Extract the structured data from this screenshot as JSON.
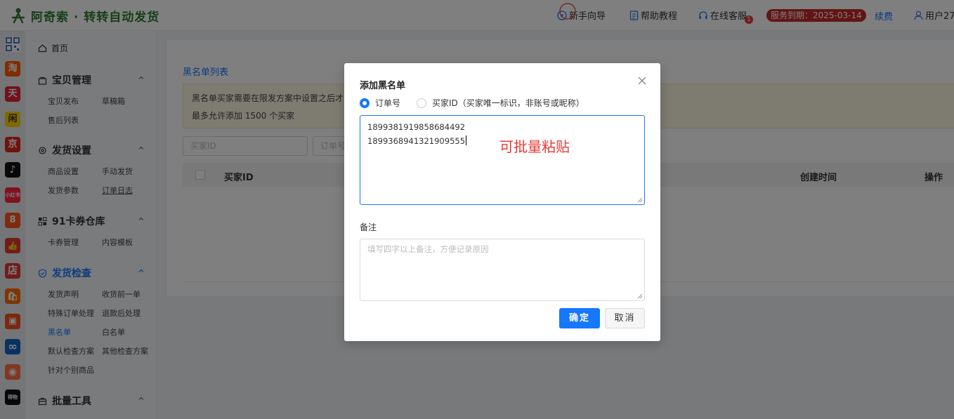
{
  "header": {
    "app_name": "阿奇索 · 转转自动发货",
    "nav": {
      "guide": "新手向导",
      "help": "帮助教程",
      "support": "在线客服",
      "support_badge": "1",
      "service_expiry": "服务到期：2025-03-14",
      "renew": "续费",
      "user": "用户27"
    }
  },
  "rail": {
    "icons": [
      {
        "name": "qr-grid-icon",
        "label": "",
        "color": "#3f6fb5"
      },
      {
        "name": "taobao-icon",
        "label": "淘",
        "color": "#ff5a00"
      },
      {
        "name": "tmall-icon",
        "label": "天",
        "color": "#e0253a"
      },
      {
        "name": "xianyu-icon",
        "label": "闲",
        "color": "#ffd500"
      },
      {
        "name": "jd-icon",
        "label": "京",
        "color": "#e1251b"
      },
      {
        "name": "douyin-icon",
        "label": "♪",
        "color": "#111111"
      },
      {
        "name": "xiaohongshu-icon",
        "label": "小红书",
        "color": "#ff2442"
      },
      {
        "name": "circle-app-icon",
        "label": "8",
        "color": "#ff5722"
      },
      {
        "name": "thumb-icon",
        "label": "👍",
        "color": "#e53935"
      },
      {
        "name": "shop-icon",
        "label": "店",
        "color": "#e53935"
      },
      {
        "name": "bag-icon",
        "label": "🛍",
        "color": "#ff6d00"
      },
      {
        "name": "store-icon",
        "label": "▣",
        "color": "#f4511e"
      },
      {
        "name": "link-icon",
        "label": "∞",
        "color": "#1565c0"
      },
      {
        "name": "face-icon",
        "label": "◉",
        "color": "#ff7043"
      },
      {
        "name": "dewu-icon",
        "label": "得物",
        "color": "#111111"
      }
    ]
  },
  "sidebar": {
    "home": "首页",
    "groups": [
      {
        "label": "宝贝管理",
        "items": [
          "宝贝发布",
          "草稿箱",
          "售后列表"
        ]
      },
      {
        "label": "发货设置",
        "items": [
          "商品设置",
          "手动发货",
          "发货参数",
          "订单日志"
        ]
      },
      {
        "label": "91卡券仓库",
        "items": [
          "卡券管理",
          "内容模板"
        ]
      },
      {
        "label": "发货检查",
        "items": [
          "发货声明",
          "收货前一单",
          "特殊订单处理",
          "退款后处理",
          "黑名单",
          "白名单",
          "默认检查方案",
          "其他检查方案",
          "针对个别商品"
        ]
      },
      {
        "label": "批量工具",
        "items": []
      }
    ]
  },
  "content": {
    "list_title": "黑名单列表",
    "notice_line1": "黑名单买家需要在限发方案中设置之后才",
    "notice_line2": "最多允许添加 1500 个买家",
    "search_buyer_placeholder": "买家ID",
    "search_order_placeholder": "订单号",
    "columns": {
      "buyer_id": "买家ID",
      "created": "创建时间",
      "action": "操作"
    }
  },
  "modal": {
    "title": "添加黑名单",
    "radio_order": "订单号",
    "radio_buyer": "买家ID（买家唯一标识，非账号或昵称）",
    "selected": "订单号",
    "ids_line1": "1899381919858684492",
    "ids_line2": "1899368941321909555",
    "hint": "可批量粘贴",
    "remark_label": "备注",
    "remark_placeholder": "填写四字以上备注，方便记录原因",
    "ok": "确定",
    "cancel": "取消"
  }
}
